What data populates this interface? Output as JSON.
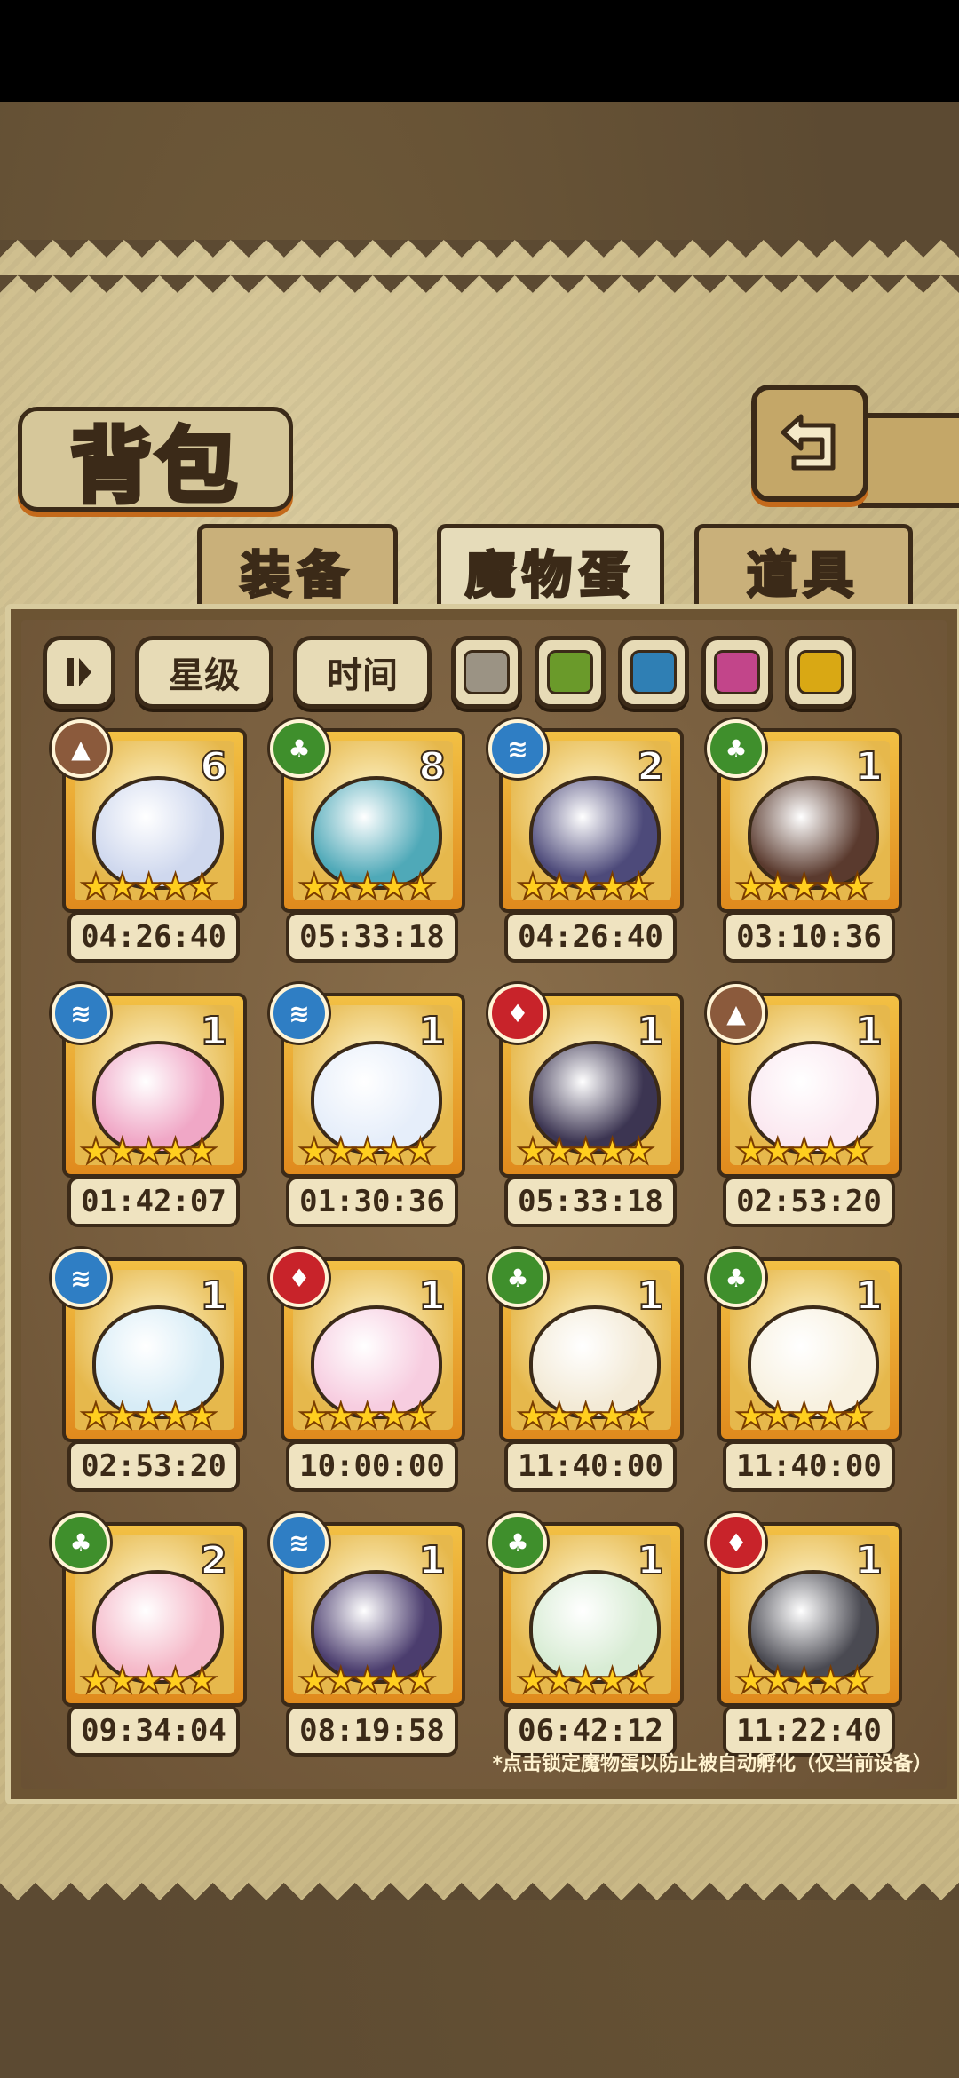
{
  "title": "背包",
  "tabs": [
    "装备",
    "魔物蛋",
    "道具"
  ],
  "active_tab": "魔物蛋",
  "filters": {
    "star_label": "星级",
    "time_label": "时间",
    "swatches": [
      "#9b9384",
      "#6a9a2a",
      "#2f7fb4",
      "#c2458a",
      "#d9a814"
    ]
  },
  "element_colors": {
    "earth": "#8b5a3c",
    "nature": "#3f8f2c",
    "water": "#2f7ec4",
    "fire": "#c8232a"
  },
  "eggs": [
    {
      "element": "earth",
      "count": "6",
      "timer": "04:26:40",
      "color": "#cfd8ee"
    },
    {
      "element": "nature",
      "count": "8",
      "timer": "05:33:18",
      "color": "#4fa9b8"
    },
    {
      "element": "water",
      "count": "2",
      "timer": "04:26:40",
      "color": "#4d4a7a"
    },
    {
      "element": "nature",
      "count": "1",
      "timer": "03:10:36",
      "color": "#5a3a2e"
    },
    {
      "element": "water",
      "count": "1",
      "timer": "01:42:07",
      "color": "#f0a7c6"
    },
    {
      "element": "water",
      "count": "1",
      "timer": "01:30:36",
      "color": "#e6eefa"
    },
    {
      "element": "fire",
      "count": "1",
      "timer": "05:33:18",
      "color": "#3c3552"
    },
    {
      "element": "earth",
      "count": "1",
      "timer": "02:53:20",
      "color": "#fbe8f0"
    },
    {
      "element": "water",
      "count": "1",
      "timer": "02:53:20",
      "color": "#d7ecf6"
    },
    {
      "element": "fire",
      "count": "1",
      "timer": "10:00:00",
      "color": "#f7cde0"
    },
    {
      "element": "nature",
      "count": "1",
      "timer": "11:40:00",
      "color": "#f3ead6"
    },
    {
      "element": "nature",
      "count": "1",
      "timer": "11:40:00",
      "color": "#f8f1e0"
    },
    {
      "element": "nature",
      "count": "2",
      "timer": "09:34:04",
      "color": "#f5b8c8"
    },
    {
      "element": "water",
      "count": "1",
      "timer": "08:19:58",
      "color": "#4b3d6e"
    },
    {
      "element": "nature",
      "count": "1",
      "timer": "06:42:12",
      "color": "#d8ecd4"
    },
    {
      "element": "fire",
      "count": "1",
      "timer": "11:22:40",
      "color": "#4a4a52"
    }
  ],
  "rating_stars": 5,
  "footnote": "*点击锁定魔物蛋以防止被自动孵化（仅当前设备）"
}
